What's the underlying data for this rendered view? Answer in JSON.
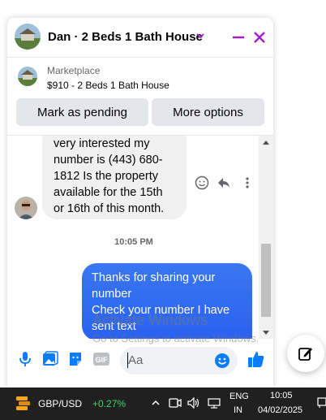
{
  "header": {
    "title": "Dan · 2 Beds 1 Bath House"
  },
  "marketplace": {
    "label": "Marketplace",
    "listing": "$910 - 2 Beds 1 Bath House",
    "mark_pending": "Mark as pending",
    "more_options": "More options"
  },
  "messages": {
    "incoming": "very interested  my\nnumber  is (443) 680-\n1812 Is the property\navailable  for the  15th\nor 16th  of this month.",
    "timestamp": "10:05 PM",
    "outgoing_line1": "Thanks for sharing your number",
    "outgoing_line2": "Check your number I have sent text"
  },
  "composer": {
    "placeholder": "Aa"
  },
  "watermark": {
    "line1": "Activate Windows",
    "line2": "Go to Settings to activate Windows."
  },
  "taskbar": {
    "ticker_name": "GBP/USD",
    "ticker_change": "+0.27%",
    "lang1": "ENG",
    "lang2": "IN",
    "time": "10:05",
    "date": "04/02/2025"
  },
  "colors": {
    "accent": "#a020c8",
    "bubble_out": "#2f6bf0",
    "icon_blue": "#0a7cff",
    "positive": "#3fd36b"
  }
}
